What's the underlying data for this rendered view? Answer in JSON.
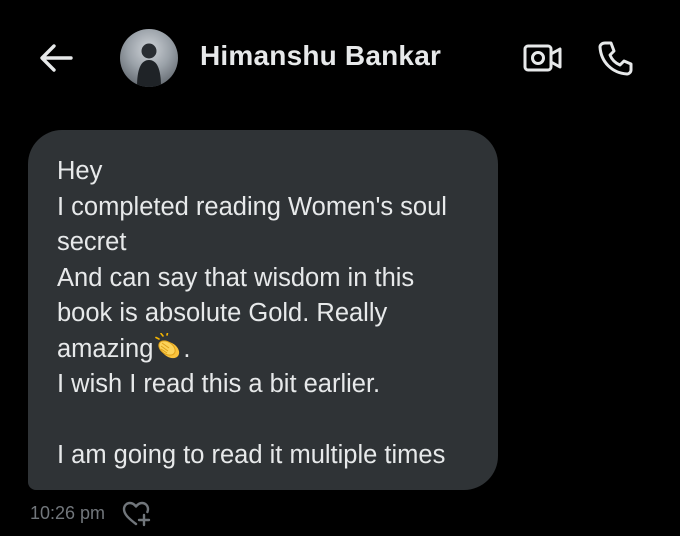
{
  "header": {
    "contact_name": "Himanshu Bankar",
    "back_icon": "arrow-left-icon",
    "video_icon": "video-camera-icon",
    "call_icon": "phone-icon"
  },
  "message": {
    "lines": [
      "Hey",
      "I completed reading Women's soul",
      "secret",
      "And can say that wisdom in this",
      "book is absolute Gold. Really",
      "amazing",
      "I wish I read this a bit earlier.",
      "",
      "I am going to read it multiple times"
    ],
    "emoji_after_amazing": "clapping-hands-icon",
    "amazing_suffix": ".",
    "timestamp": "10:26 pm",
    "react_icon": "heart-plus-icon"
  },
  "colors": {
    "background": "#000000",
    "bubble": "#2f3336",
    "text": "#e7e9ea",
    "muted": "#71767b"
  }
}
